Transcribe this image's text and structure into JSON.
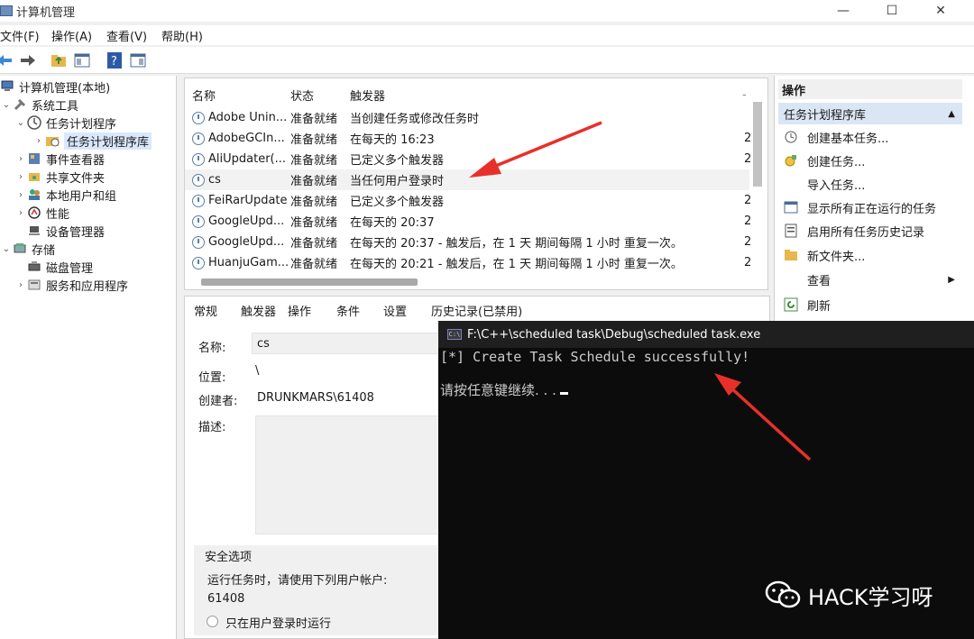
{
  "window": {
    "title": "计算机管理",
    "minimize": "—",
    "maximize": "☐",
    "close": "✕"
  },
  "menu": [
    "文件(F)",
    "操作(A)",
    "查看(V)",
    "帮助(H)"
  ],
  "tree": {
    "root": "计算机管理(本地)",
    "system_tools": "系统工具",
    "task_scheduler": "任务计划程序",
    "task_library": "任务计划程序库",
    "event_viewer": "事件查看器",
    "shared_folders": "共享文件夹",
    "local_users": "本地用户和组",
    "performance": "性能",
    "device_manager": "设备管理器",
    "storage": "存储",
    "disk_mgmt": "磁盘管理",
    "services": "服务和应用程序"
  },
  "task_list": {
    "columns": [
      "名称",
      "状态",
      "触发器"
    ],
    "rows": [
      {
        "name": "Adobe Unin...",
        "status": "准备就绪",
        "trigger": "当创建任务或修改任务时",
        "extra": ""
      },
      {
        "name": "AdobeGCIn...",
        "status": "准备就绪",
        "trigger": "在每天的 16:23",
        "extra": "2"
      },
      {
        "name": "AliUpdater(...",
        "status": "准备就绪",
        "trigger": "已定义多个触发器",
        "extra": "2"
      },
      {
        "name": "cs",
        "status": "准备就绪",
        "trigger": "当任何用户登录时",
        "extra": ""
      },
      {
        "name": "FeiRarUpdate",
        "status": "准备就绪",
        "trigger": "已定义多个触发器",
        "extra": "2"
      },
      {
        "name": "GoogleUpd...",
        "status": "准备就绪",
        "trigger": "在每天的 20:37",
        "extra": "2"
      },
      {
        "name": "GoogleUpd...",
        "status": "准备就绪",
        "trigger": "在每天的 20:37 - 触发后，在 1 天 期间每隔 1 小时 重复一次。",
        "extra": "2"
      },
      {
        "name": "HuanjuGam...",
        "status": "准备就绪",
        "trigger": "在每天的 20:21 - 触发后，在 1 天 期间每隔 1 小时 重复一次。",
        "extra": "2"
      }
    ]
  },
  "detail": {
    "tabs": [
      "常规",
      "触发器",
      "操作",
      "条件",
      "设置",
      "历史记录(已禁用)"
    ],
    "name_label": "名称:",
    "name_value": "cs",
    "location_label": "位置:",
    "location_value": "\\",
    "author_label": "创建者:",
    "author_value": "DRUNKMARS\\61408",
    "desc_label": "描述:",
    "security_title": "安全选项",
    "run_as_label": "运行任务时，请使用下列用户帐户:",
    "run_as_value": "61408",
    "radio_label": "只在用户登录时运行"
  },
  "actions": {
    "header": "操作",
    "section": "任务计划程序库",
    "items": [
      "创建基本任务...",
      "创建任务...",
      "导入任务...",
      "显示所有正在运行的任务",
      "启用所有任务历史记录",
      "新文件夹...",
      "查看",
      "刷新"
    ]
  },
  "console": {
    "title": "F:\\C++\\scheduled task\\Debug\\scheduled task.exe",
    "line1": "[*] Create Task Schedule successfully!",
    "line2": "请按任意键继续. . ."
  },
  "watermark": {
    "text": "HACK学习呀"
  },
  "colors": {
    "arrow": "#e8302a",
    "console_bg": "#0c0c0c",
    "selection": "#d9e8fb"
  }
}
